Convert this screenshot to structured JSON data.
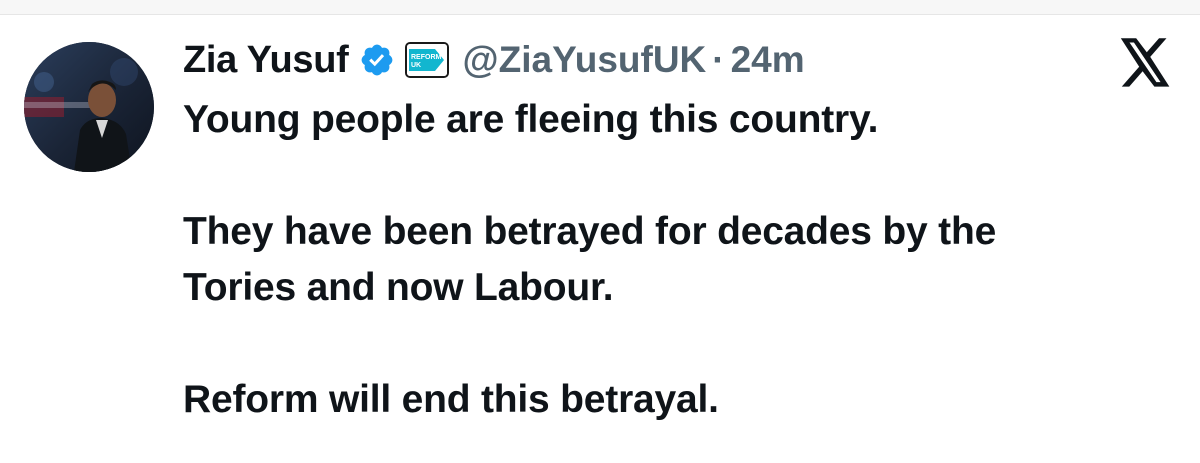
{
  "author": {
    "display_name": "Zia Yusuf",
    "handle": "@ZiaYusufUK",
    "separator": "·",
    "timestamp": "24m",
    "avatar_icon": "profile-photo",
    "verified_icon": "verified-check-icon",
    "affiliate_badge": {
      "icon": "reform-uk-logo",
      "text_line1": "REFORM",
      "text_line2": "UK",
      "color": "#12b6cf"
    }
  },
  "platform_icon": "x-logo-icon",
  "tweet": {
    "line1": "Young people are fleeing this country.",
    "line2": "They have been betrayed for decades by the",
    "line3": "Tories and now Labour.",
    "line4": "Reform will end this betrayal."
  },
  "colors": {
    "text": "#0f1419",
    "secondary": "#536471",
    "verified": "#1d9bf0"
  }
}
